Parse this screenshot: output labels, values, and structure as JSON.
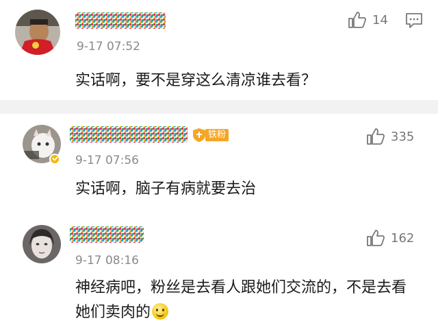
{
  "comments": [
    {
      "username": "",
      "time": "9-17 07:52",
      "text": "实话啊，要不是穿这么清凉谁去看？",
      "likes": "14"
    },
    {
      "username": "",
      "badge": "铁粉",
      "time": "9-17 07:56",
      "text": "实话啊，脑子有病就要去治",
      "likes": "335"
    },
    {
      "username": "",
      "time": "9-17 08:16",
      "text": "神经病吧，粉丝是去看人跟她们交流的，不是去看她们卖肉的",
      "likes": "162"
    }
  ],
  "colors": {
    "accent": "#f5a623",
    "separator": "#f2f2f2",
    "meta_text": "#8a8a8a"
  }
}
